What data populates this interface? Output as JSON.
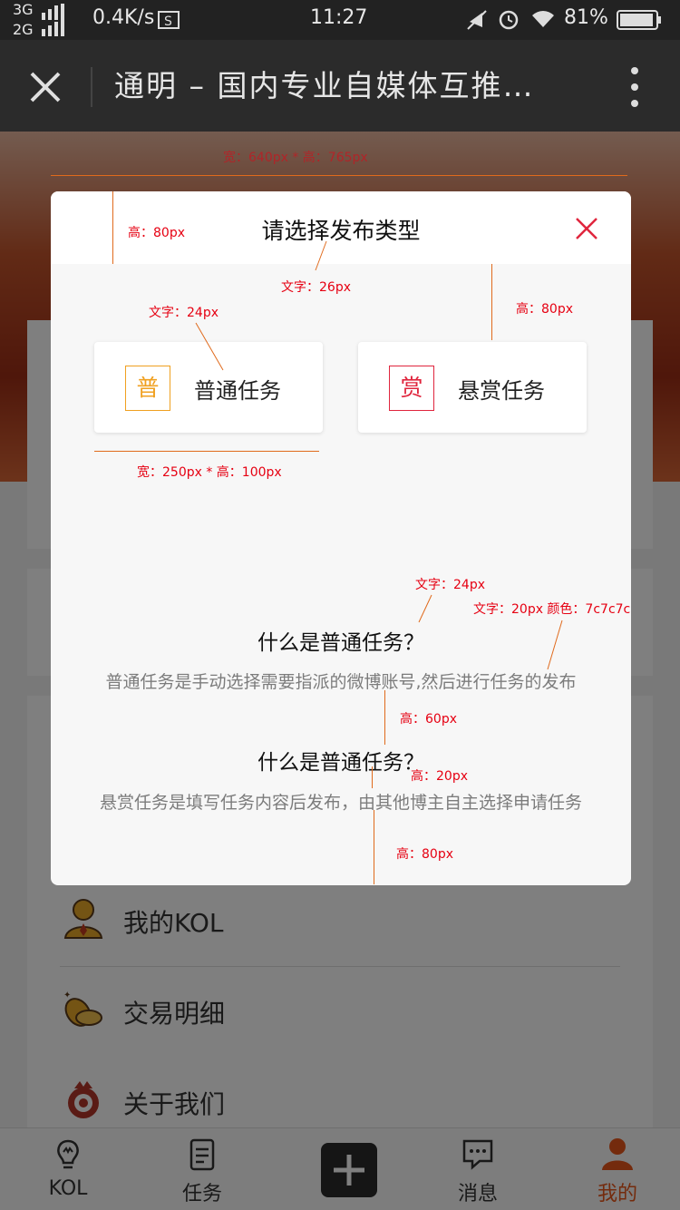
{
  "status_bar": {
    "network_top": "3G",
    "network_bottom": "2G",
    "speed": "0.4K/s",
    "time": "11:27",
    "battery": "81%"
  },
  "title_bar": {
    "title": "通明 – 国内专业自媒体互推…"
  },
  "menu": {
    "items": [
      {
        "label": "我的KOL",
        "icon": "user-kol-icon"
      },
      {
        "label": "交易明细",
        "icon": "coins-icon"
      },
      {
        "label": "关于我们",
        "icon": "about-logo-icon"
      }
    ]
  },
  "tab_bar": {
    "tabs": [
      {
        "label": "KOL",
        "icon": "lightbulb-icon"
      },
      {
        "label": "任务",
        "icon": "clipboard-icon"
      },
      {
        "label": "",
        "icon": "plus-icon"
      },
      {
        "label": "消息",
        "icon": "message-icon"
      },
      {
        "label": "我的",
        "icon": "person-icon"
      }
    ],
    "active_color": "#e8571b"
  },
  "modal": {
    "title": "请选择发布类型",
    "options": [
      {
        "badge": "普",
        "label": "普通任务",
        "color": "#f0a020"
      },
      {
        "badge": "赏",
        "label": "悬赏任务",
        "color": "#e0253d"
      }
    ],
    "sections": [
      {
        "title": "什么是普通任务？",
        "desc": "普通任务是手动选择需要指派的微博账号,然后进行任务的发布"
      },
      {
        "title": "什么是普通任务？",
        "desc": "悬赏任务是填写任务内容后发布，由其他博主自主选择申请任务"
      }
    ]
  },
  "annotations": {
    "modal_size": "宽：640px * 高：765px",
    "head_height": "高：80px",
    "title_font": "文字：26px",
    "option_font": "文字：24px",
    "option_gap": "高：80px",
    "option_size": "宽：250px * 高：100px",
    "section_title_font": "文字：24px",
    "section_desc_font": "文字：20px  颜色：7c7c7c",
    "section_gap": "高：60px",
    "title_desc_gap": "高：20px",
    "bottom_gap": "高：80px"
  }
}
